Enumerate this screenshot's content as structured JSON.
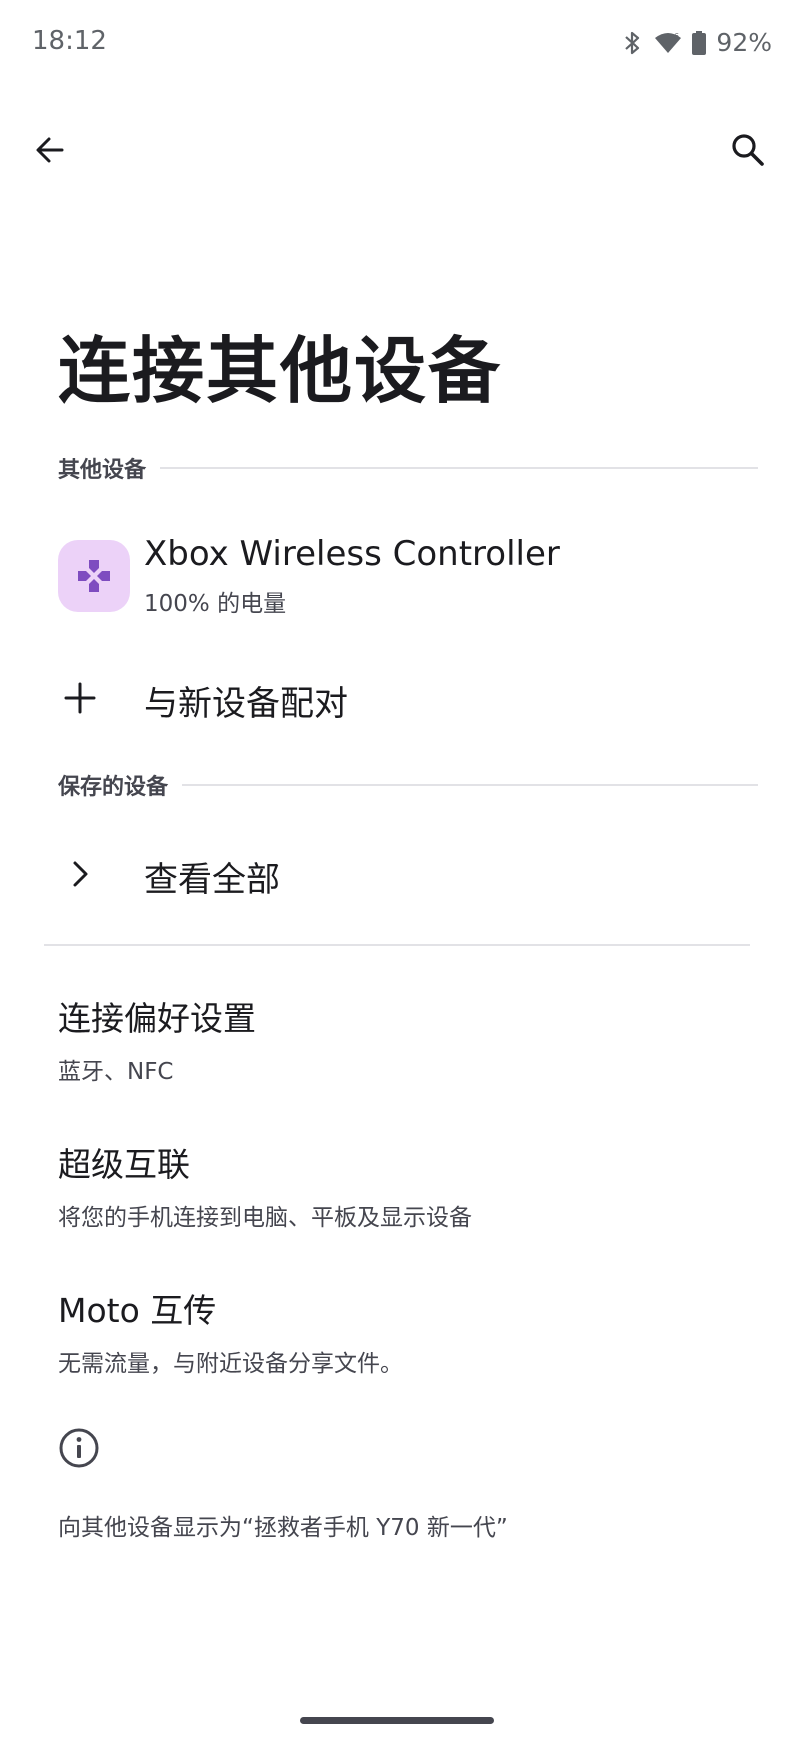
{
  "status_bar": {
    "time": "18:12",
    "battery": "92%",
    "icons": [
      "bluetooth-icon",
      "wifi-icon",
      "battery-icon"
    ]
  },
  "app_bar": {
    "back_icon": "arrow-left-icon",
    "search_icon": "search-icon"
  },
  "page": {
    "title": "连接其他设备"
  },
  "sections": {
    "other_devices": "其他设备",
    "saved_devices": "保存的设备"
  },
  "device": {
    "name": "Xbox Wireless Controller",
    "status": "100% 的电量",
    "icon": "gamepad-icon",
    "icon_bg": "#ecd2f8",
    "icon_color": "#7e4cc0"
  },
  "actions": {
    "pair_new": "与新设备配对",
    "see_all": "查看全部"
  },
  "preferences": [
    {
      "title": "连接偏好设置",
      "subtitle": "蓝牙、NFC"
    },
    {
      "title": "超级互联",
      "subtitle": "将您的手机连接到电脑、平板及显示设备"
    },
    {
      "title": "Moto 互传",
      "subtitle": "无需流量，与附近设备分享文件。"
    }
  ],
  "footer": {
    "visible_as": "向其他设备显示为“拯救者手机 Y70 新一代”"
  }
}
